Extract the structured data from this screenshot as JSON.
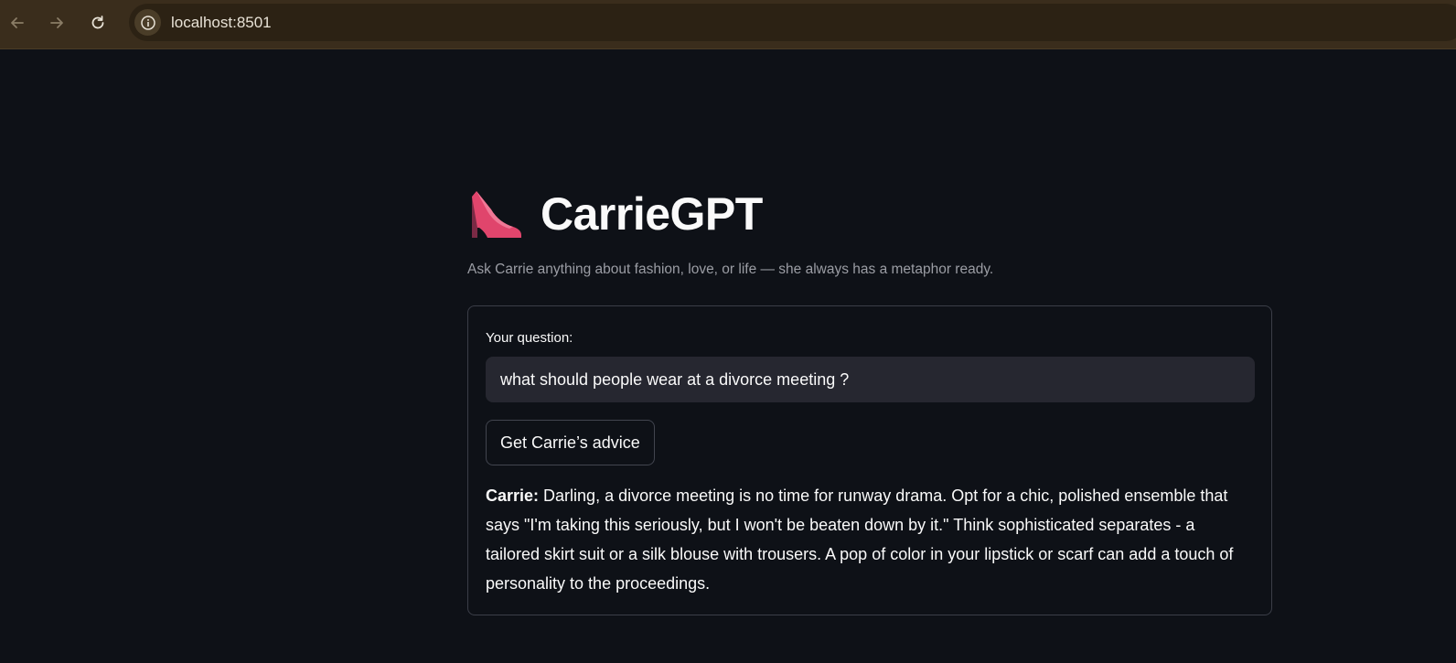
{
  "browser": {
    "url": "localhost:8501",
    "icons": {
      "back": "arrow-left-icon",
      "forward": "arrow-right-icon",
      "reload": "reload-icon",
      "info": "info-icon"
    }
  },
  "app": {
    "icon": "high-heel-icon",
    "title": "CarrieGPT",
    "subtitle": "Ask Carrie anything about fashion, love, or life — she always has a metaphor ready."
  },
  "form": {
    "question_label": "Your question:",
    "question_value": "what should people wear at a divorce meeting ?",
    "submit_label": "Get Carrie’s advice"
  },
  "response": {
    "speaker": "Carrie:",
    "text": "Darling, a divorce meeting is no time for runway drama. Opt for a chic, polished ensemble that says \"I'm taking this seriously, but I won't be beaten down by it.\" Think sophisticated separates - a tailored skirt suit or a silk blouse with trousers. A pop of color in your lipstick or scarf can add a touch of personality to the proceedings."
  },
  "colors": {
    "background": "#0e1117",
    "browser_bar": "#3a2d1c",
    "input_bg": "#262730",
    "heel": "#e0456c"
  }
}
